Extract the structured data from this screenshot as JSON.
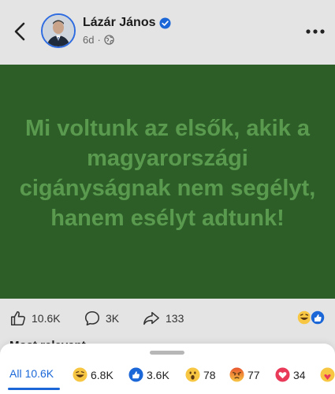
{
  "header": {
    "author": "Lázár János",
    "time": "6d",
    "separator": "·"
  },
  "post": {
    "text": "Mi voltunk az elsők, akik a magyarországi cigányságnak nem segélyt, hanem esélyt adtunk!",
    "background_color": "#2d5e28",
    "text_color": "#5a9a4f"
  },
  "stats": {
    "likes": "10.6K",
    "comments": "3K",
    "shares": "133"
  },
  "peek_text": "Most relevant",
  "reactions_sheet": {
    "tabs": [
      {
        "label": "All",
        "count": "10.6K",
        "icon": null
      },
      {
        "label": "",
        "count": "6.8K",
        "icon": "laugh-emoji-icon"
      },
      {
        "label": "",
        "count": "3.6K",
        "icon": "like-reaction-icon"
      },
      {
        "label": "",
        "count": "78",
        "icon": "wow-emoji-icon"
      },
      {
        "label": "",
        "count": "77",
        "icon": "angry-emoji-icon"
      },
      {
        "label": "",
        "count": "34",
        "icon": "love-reaction-icon"
      },
      {
        "label": "",
        "count": "",
        "icon": "care-emoji-icon"
      }
    ]
  },
  "colors": {
    "accent": "#1b67d8",
    "verified": "#1b67d8",
    "avatar_ring": "#2d6be0"
  }
}
